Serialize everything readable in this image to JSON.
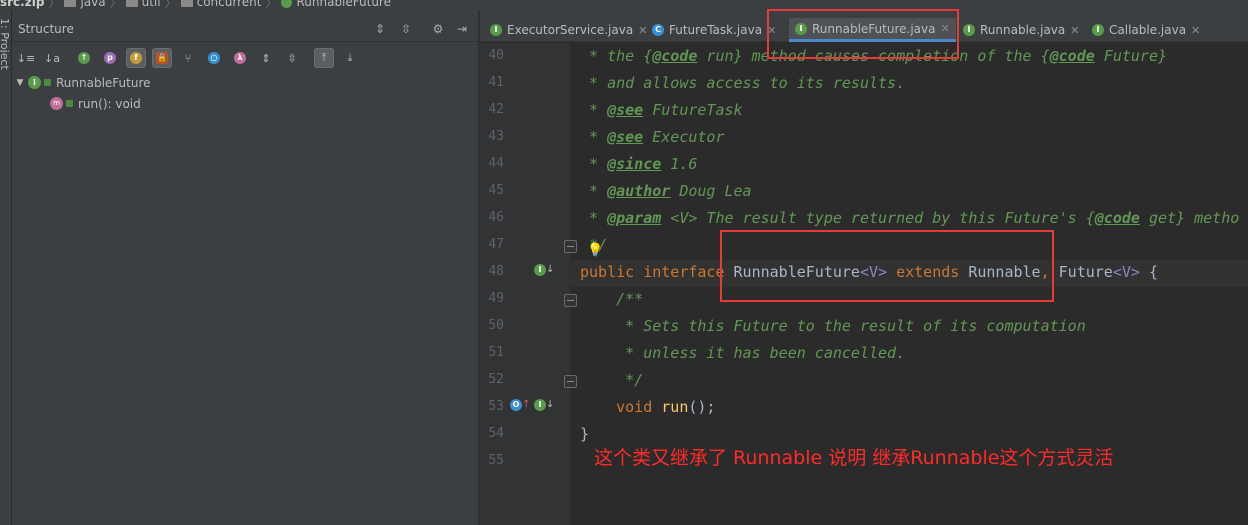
{
  "breadcrumb": {
    "items": [
      {
        "label": "src.zip"
      },
      {
        "label": "java"
      },
      {
        "label": "util"
      },
      {
        "label": "concurrent"
      },
      {
        "label": "RunnableFuture"
      }
    ]
  },
  "side_strip": {
    "label": "1: Project"
  },
  "structure": {
    "title": "Structure",
    "tree": {
      "root_label": "RunnableFuture",
      "children": [
        {
          "label": "run(): void"
        }
      ]
    }
  },
  "tabs": [
    {
      "label": "ExecutorService.java",
      "icon": "interface-icon"
    },
    {
      "label": "FutureTask.java",
      "icon": "class-icon"
    },
    {
      "label": "RunnableFuture.java",
      "icon": "interface-icon",
      "active": true
    },
    {
      "label": "Runnable.java",
      "icon": "interface-icon"
    },
    {
      "label": "Callable.java",
      "icon": "interface-icon"
    }
  ],
  "line_numbers": [
    "40",
    "41",
    "42",
    "43",
    "44",
    "45",
    "46",
    "47",
    "48",
    "49",
    "50",
    "51",
    "52",
    "53",
    "54",
    "55"
  ],
  "code": {
    "l40": {
      "a": " * the {",
      "b": "@code",
      "c": " run} method causes completion of the {",
      "d": "@code",
      "e": " Future}"
    },
    "l41": " * and allows access to its results.",
    "l42": {
      "a": " * ",
      "tag": "@see",
      "rest": " FutureTask"
    },
    "l43": {
      "a": " * ",
      "tag": "@see",
      "rest": " Executor"
    },
    "l44": {
      "a": " * ",
      "tag": "@since",
      "rest": " 1.6"
    },
    "l45": {
      "a": " * ",
      "tag": "@author",
      "rest": " Doug Lea"
    },
    "l46": {
      "a": " * ",
      "tag": "@param",
      "b": " <V> The result type returned by this Future's {",
      "c": "@code",
      "d": " get} metho"
    },
    "l47": " */",
    "l48": {
      "kw1": "public interface ",
      "name": "RunnableFuture",
      "tp1": "<V>",
      "kw2": " extends ",
      "r": "Runnable",
      "comma": ", ",
      "f": "Future",
      "tp2": "<V>",
      "brace": " {"
    },
    "l49": "    /**",
    "l50": "     * Sets this Future to the result of its computation",
    "l51": "     * unless it has been cancelled.",
    "l52": "     */",
    "l53": {
      "kw": "    void ",
      "fn": "run",
      "p": "();"
    },
    "l54": "}"
  },
  "annotation": {
    "text": "这个类又继承了 Runnable   说明 继承Runnable这个方式灵活"
  },
  "colors": {
    "highlight_box": "#e83a3a",
    "comment": "#629755",
    "keyword": "#cc7832",
    "annotation_text": "#ff2a2a"
  }
}
